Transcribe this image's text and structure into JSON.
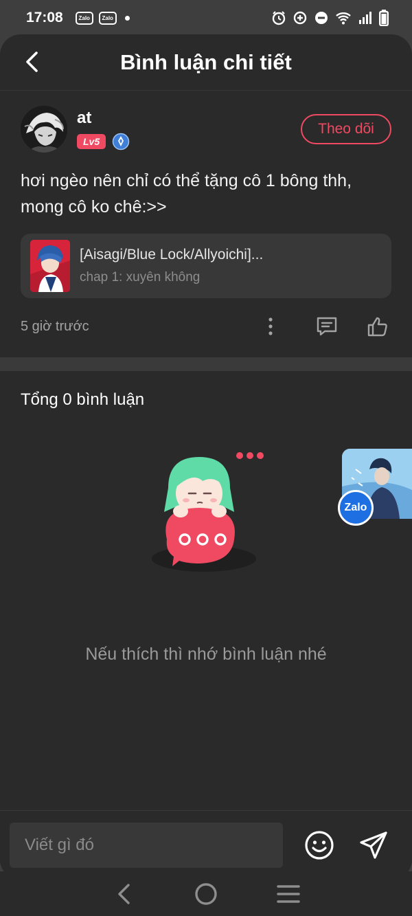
{
  "status_bar": {
    "time": "17:08",
    "notif_icons": [
      "Zalo",
      "Zalo"
    ],
    "right_icons": [
      "alarm-icon",
      "data-saver-icon",
      "dnd-icon",
      "wifi-icon",
      "signal-icon",
      "battery-icon"
    ]
  },
  "header": {
    "title": "Bình luận chi tiết",
    "back_icon": "chevron-left-icon"
  },
  "comment": {
    "author": "at",
    "level": "Lv5",
    "follow_label": "Theo dõi",
    "text": "hơi ngèo nên chỉ có thể tặng cô 1 bông thh, mong cô ko chê:>>",
    "story": {
      "title": "[Aisagi/Blue Lock/Allyoichi]...",
      "chapter": "chap 1: xuyên không"
    },
    "time": "5 giờ trước"
  },
  "comments_section": {
    "total_label": "Tổng 0 bình luận",
    "empty_message": "Nếu thích thì nhớ bình luận nhé"
  },
  "zalo_float": {
    "label": "Zalo"
  },
  "input": {
    "placeholder": "Viết gì đó"
  },
  "colors": {
    "accent": "#f04a63",
    "background": "#2a2a2a",
    "card": "#383838",
    "mascot_hair": "#5fdba8"
  }
}
